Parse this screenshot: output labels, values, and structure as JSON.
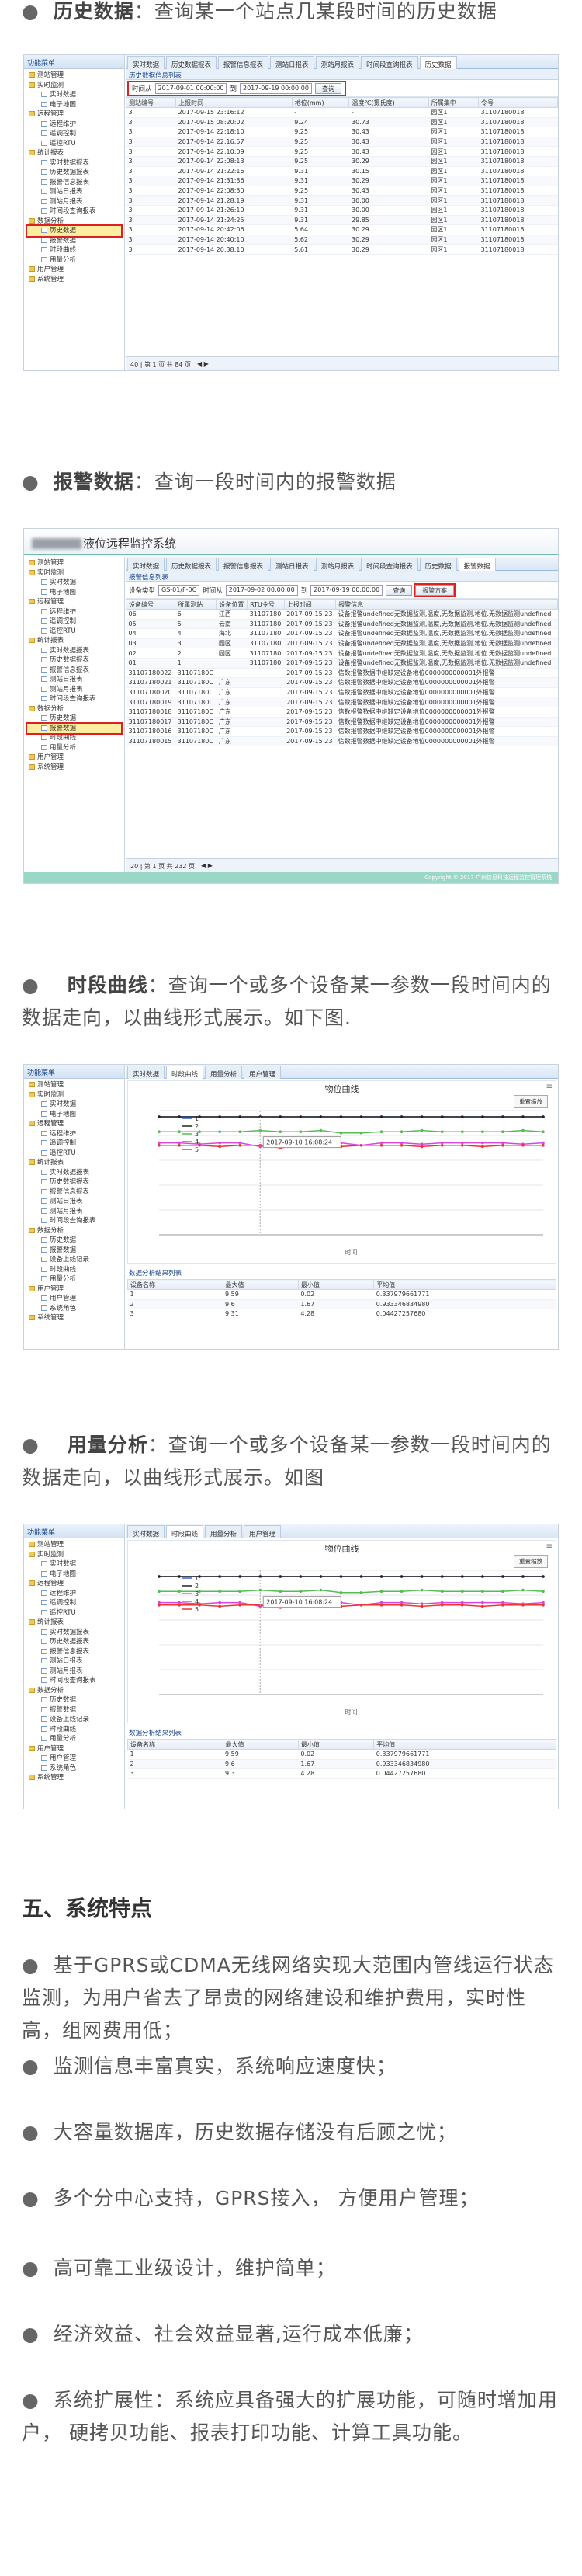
{
  "sections": {
    "history": {
      "label": "历史数据",
      "desc": "：查询某一个站点几某段时间的历史数据"
    },
    "alarm": {
      "label": "报警数据",
      "desc": "：查询一段时间内的报警数据"
    },
    "period": {
      "label": "时段曲线",
      "desc": "：查询一个或多个设备某一参数一段时间内的数据走向，以曲线形式展示。如下图."
    },
    "usage": {
      "label": "用量分析",
      "desc": "：查询一个或多个设备某一参数一段时间内的数据走向，以曲线形式展示。如图"
    },
    "features_heading": "五、系统特点",
    "features": [
      "基于GPRS或CDMA无线网络实现大范围内管线运行状态监测，为用户省去了昂贵的网络建设和维护费用，实时性高，组网费用低；",
      "监测信息丰富真实，系统响应速度快；",
      "大容量数据库，历史数据存储没有后顾之忧；",
      "多个分中心支持，GPRS接入， 方便用户管理；",
      "高可靠工业级设计，维护简单；",
      "经济效益、社会效益显著,运行成本低廉；",
      "系统扩展性：系统应具备强大的扩展功能，可随时增加用户， 硬拷贝功能、报表打印功能、计算工具功能。"
    ]
  },
  "ui": {
    "sidebar_title": "功能菜单",
    "tree1": [
      "田 测站管理",
      "□ 实时监测",
      "实时数据",
      "电子地图",
      "□ 远程管理",
      "远程维护",
      "遥调控制",
      "遥控RTU",
      "□ 统计报表",
      "实时数据报表",
      "历史数据报表",
      "报警信息报表",
      "测站日报表",
      "测站月报表",
      "时间段查询报表",
      "□ 数据分析",
      "历史数据",
      "报警数据",
      "时段曲线",
      "用量分析",
      "田 用户管理",
      "田 系统管理"
    ],
    "tree_chart": [
      "田 测站管理",
      "□ 实时监测",
      "实时数据",
      "电子地图",
      "□ 远程管理",
      "远程维护",
      "遥调控制",
      "遥控RTU",
      "□ 统计报表",
      "实时数据报表",
      "历史数据报表",
      "报警信息报表",
      "测站日报表",
      "测站月报表",
      "时间段查询报表",
      "□ 数据分析",
      "历史数据",
      "报警数据",
      "设备上线记录",
      "时段曲线",
      "用量分析",
      "□ 用户管理",
      "用户管理",
      "系统角色",
      "□ 系统管理"
    ],
    "tabs": [
      "实时数据",
      "历史数据报表",
      "报警信息报表",
      "测站日报表",
      "测站月报表",
      "时间段查询报表",
      "历史数据"
    ],
    "tabs_alarm": [
      "实时数据",
      "历史数据报表",
      "报警信息报表",
      "测站日报表",
      "测站月报表",
      "时间段查询报表",
      "历史数据",
      "报警数据"
    ],
    "tabs_chart": [
      "实时数据",
      "时段曲线",
      "用量分析",
      "用户管理"
    ],
    "history_panel": "历史数据信息列表",
    "time_label": "时间从",
    "time_from": "2017-09-01 00:00:00",
    "time_to_label": "到",
    "time_to": "2017-09-19 00:00:00",
    "query": "查询",
    "history_cols": [
      "测站编号",
      "上报时间",
      "地位(mm)",
      "温度℃(摄氏度)",
      "所属集中",
      "令号"
    ],
    "history_rows": [
      [
        "3",
        "2017-09-15 23:16:12",
        "-",
        "-",
        "园区1",
        "31107180018"
      ],
      [
        "3",
        "2017-09-15 08:20:02",
        "9.24",
        "30.73",
        "园区1",
        "31107180018"
      ],
      [
        "3",
        "2017-09-14 22:18:10",
        "9.25",
        "30.43",
        "园区1",
        "31107180018"
      ],
      [
        "3",
        "2017-09-14 22:16:57",
        "9.25",
        "30.43",
        "园区1",
        "31107180018"
      ],
      [
        "3",
        "2017-09-14 22:10:09",
        "9.25",
        "30.43",
        "园区1",
        "31107180018"
      ],
      [
        "3",
        "2017-09-14 22:08:13",
        "9.25",
        "30.29",
        "园区1",
        "31107180018"
      ],
      [
        "3",
        "2017-09-14 21:22:16",
        "9.31",
        "30.15",
        "园区1",
        "31107180018"
      ],
      [
        "3",
        "2017-09-14 21:31:36",
        "9.31",
        "30.29",
        "园区1",
        "31107180018"
      ],
      [
        "3",
        "2017-09-14 22:08:30",
        "9.25",
        "30.43",
        "园区1",
        "31107180018"
      ],
      [
        "3",
        "2017-09-14 21:28:19",
        "9.31",
        "30.00",
        "园区1",
        "31107180018"
      ],
      [
        "3",
        "2017-09-14 21:26:10",
        "9.31",
        "30.00",
        "园区1",
        "31107180018"
      ],
      [
        "3",
        "2017-09-14 21:24:25",
        "9.31",
        "29.85",
        "园区1",
        "31107180018"
      ],
      [
        "3",
        "2017-09-14 20:42:06",
        "5.64",
        "30.29",
        "园区1",
        "31107180018"
      ],
      [
        "3",
        "2017-09-14 20:40:10",
        "5.62",
        "30.29",
        "园区1",
        "31107180018"
      ],
      [
        "3",
        "2017-09-14 20:38:10",
        "5.61",
        "30.29",
        "园区1",
        "31107180018"
      ]
    ],
    "pager": "40 | 第 1 页 共 84 页",
    "alarm_title": "液位远程监控系统",
    "alarm_panel": "报警信息列表",
    "alarm_type_label": "设备类型",
    "alarm_type": "GS-01/F-0C",
    "alarm_time_from": "2017-09-02 00:00:00",
    "alarm_time_to": "2017-09-19 00:00:00",
    "alarm_export": "报警方案",
    "alarm_cols": [
      "设备编号",
      "所属测站",
      "设备位置",
      "RTU令号",
      "上报时间",
      "报警信息"
    ],
    "alarm_rows": [
      [
        "06",
        "6",
        "江西",
        "31107180",
        "2017-09-15 23",
        "设备报警undefined无数据监测,温度,无数据监测,地位.无数据监测undefined"
      ],
      [
        "05",
        "5",
        "云南",
        "31107180",
        "2017-09-15 23",
        "设备报警undefined无数据监测,温度,无数据监测,地位.无数据监测undefined"
      ],
      [
        "04",
        "4",
        "海北",
        "31107180",
        "2017-09-15 23",
        "设备报警undefined无数据监测,温度,无数据监测,地位.无数据监测undefined"
      ],
      [
        "03",
        "3",
        "园区",
        "31107180",
        "2017-09-15 23",
        "设备报警undefined无数据监测,温度,无数据监测,地位.无数据监测undefined"
      ],
      [
        "02",
        "2",
        "园区",
        "31107180",
        "2017-09-15 23",
        "设备报警undefined无数据监测,温度,无数据监测,地位.无数据监测undefined"
      ],
      [
        "01",
        "1",
        "",
        "31107180",
        "2017-09-15 23",
        "设备报警undefined无数据监测,温度,无数据监测,地位.无数据监测undefined"
      ],
      [
        "31107180022",
        "31107180C",
        "",
        "",
        "2017-09-15 23",
        "信数报警数据中继缺定设备地位0000000000001外报警"
      ],
      [
        "31107180021",
        "31107180C",
        "广东",
        "",
        "2017-09-15 23",
        "信数报警数据中继缺定设备地位0000000000001外报警"
      ],
      [
        "31107180020",
        "31107180C",
        "广东",
        "",
        "2017-09-15 23",
        "信数报警数据中继缺定设备地位0000000000001外报警"
      ],
      [
        "31107180019",
        "31107180C",
        "广东",
        "",
        "2017-09-15 23",
        "信数报警数据中继缺定设备地位0000000000001外报警"
      ],
      [
        "31107180018",
        "31107180C",
        "广东",
        "",
        "2017-09-15 23",
        "信数报警数据中继缺定设备地位0000000000001外报警"
      ],
      [
        "31107180017",
        "31107180C",
        "广东",
        "",
        "2017-09-15 23",
        "信数报警数据中继缺定设备地位0000000000001外报警"
      ],
      [
        "31107180016",
        "31107180C",
        "广东",
        "",
        "2017-09-15 23",
        "信数报警数据中继缺定设备地位0000000000001外报警"
      ],
      [
        "31107180015",
        "31107180C",
        "广东",
        "",
        "2017-09-15 23",
        "信数报警数据中继缺定设备地位0000000000001外报警"
      ]
    ],
    "alarm_pager": "20 | 第 1 页 共 232 页",
    "copyright": "Copyright © 2017 广州信息科技远程监控管理系统",
    "chart_title": "物位曲线",
    "reset_zoom": "重置缩放",
    "tooltip": "2017-09-10 16:08:24",
    "x_axis_label": "时间",
    "analysis_title": "数据分析结果列表",
    "analysis_cols": [
      "设备名称",
      "最大值",
      "最小值",
      "平均值"
    ],
    "analysis_rows": [
      [
        "1",
        "9.59",
        "0.02",
        "0.337979661771"
      ],
      [
        "2",
        "9.6",
        "1.67",
        "0.933346834980"
      ],
      [
        "3",
        "9.31",
        "4.28",
        "0.04427257680"
      ]
    ]
  },
  "chart_data": [
    {
      "type": "line",
      "title": "物位曲线",
      "xlabel": "时间",
      "ylabel": "",
      "ylim": [
        0,
        10
      ],
      "series": [
        {
          "name": "1",
          "values": [
            9.5,
            9.5,
            9.5,
            9.5,
            9.5,
            9.5,
            9.5,
            9.5,
            9.5,
            9.5,
            9.5,
            9.5,
            9.5,
            9.5,
            9.5,
            9.5,
            9.5,
            9.5,
            9.5,
            9.5
          ]
        },
        {
          "name": "2",
          "values": [
            9.5,
            9.5,
            9.5,
            9.5,
            9.5,
            9.5,
            9.5,
            9.5,
            9.5,
            9.5,
            9.5,
            9.5,
            9.5,
            9.5,
            9.5,
            9.5,
            9.5,
            9.5,
            9.5,
            9.5
          ]
        },
        {
          "name": "3",
          "values": [
            8.3,
            8.3,
            8.3,
            8.3,
            8.3,
            8.4,
            8.3,
            8.3,
            8.4,
            8.2,
            8.2,
            8.3,
            8.3,
            8.4,
            8.3,
            8.3,
            8.3,
            8.3,
            8.4,
            8.3
          ]
        },
        {
          "name": "4",
          "values": [
            7.4,
            7.4,
            7.3,
            7.4,
            7.4,
            7.1,
            7.4,
            7.4,
            7.3,
            7.4,
            7.2,
            7.4,
            7.4,
            7.3,
            7.4,
            7.4,
            7.4,
            7.4,
            7.3,
            7.4
          ]
        },
        {
          "name": "5",
          "values": [
            7.2,
            7.2,
            7.2,
            7.1,
            7.2,
            7.2,
            7.0,
            7.2,
            7.2,
            7.1,
            7.2,
            7.2,
            7.2,
            7.1,
            7.2,
            7.2,
            7.1,
            7.2,
            7.2,
            7.2
          ]
        }
      ],
      "colors": [
        "#3366cc",
        "#222222",
        "#55bb55",
        "#dd44dd",
        "#ee3333"
      ]
    }
  ]
}
